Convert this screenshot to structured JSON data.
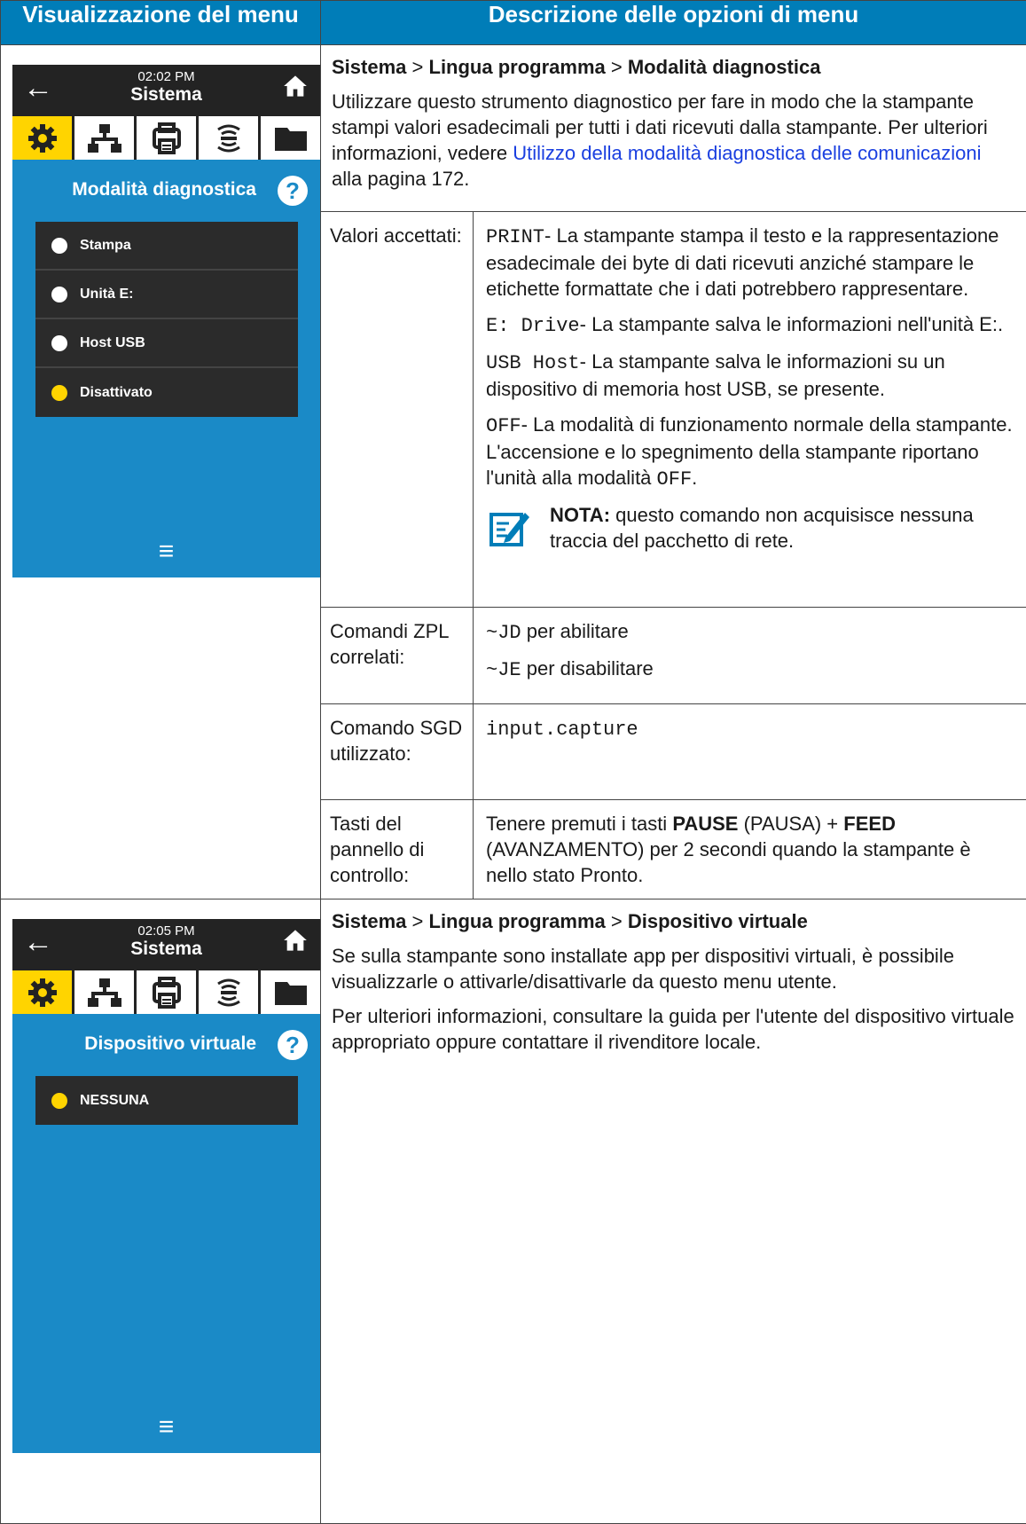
{
  "headers": {
    "left": "Visualizzazione del menu",
    "right": "Descrizione delle opzioni di menu"
  },
  "screen1": {
    "time": "02:02 PM",
    "title": "Sistema",
    "heading": "Modalità diagnostica",
    "items": [
      {
        "label": "Stampa",
        "selected": false
      },
      {
        "label": "Unità E:",
        "selected": false
      },
      {
        "label": "Host USB",
        "selected": false
      },
      {
        "label": "Disattivato",
        "selected": true
      }
    ]
  },
  "screen2": {
    "time": "02:05 PM",
    "title": "Sistema",
    "heading": "Dispositivo virtuale",
    "items": [
      {
        "label": "NESSUNA",
        "selected": true
      }
    ]
  },
  "section1": {
    "crumb": {
      "a": "Sistema",
      "sep": ">",
      "b": "Lingua programma",
      "c": "Modalità diagnostica"
    },
    "intro_before": "Utilizzare questo strumento diagnostico per fare in modo che la stampante stampi valori esadecimali per tutti i dati ricevuti dalla stampante. Per ulteriori informazioni, vedere ",
    "intro_link": "Utilizzo della modalità diagnostica delle comunicazioni",
    "intro_after": " alla pagina 172.",
    "values_label": "Valori accettati:",
    "values": [
      {
        "code": "PRINT",
        "text": "- La stampante stampa il testo e la rappresentazione esadecimale dei byte di dati ricevuti anziché stampare le etichette formattate che i dati potrebbero rappresentare."
      },
      {
        "code": "E: Drive",
        "text": "- La stampante salva le informazioni nell'unità E:."
      },
      {
        "code": "USB Host",
        "text": "- La stampante salva le informazioni su un dispositivo di memoria host USB, se presente."
      },
      {
        "code": "OFF",
        "text": "- La modalità di funzionamento normale della stampante. L'accensione e lo spegnimento della stampante riportano l'unità alla modalità ",
        "code2": "OFF",
        "tail": "."
      }
    ],
    "note_label": "NOTA:",
    "note_text": " questo comando non acquisisce nessuna traccia del pacchetto di rete.",
    "zpl_label": "Comandi ZPL correlati:",
    "zpl": [
      {
        "code": "~JD",
        "text": " per abilitare"
      },
      {
        "code": "~JE",
        "text": " per disabilitare"
      }
    ],
    "sgd_label": "Comando SGD utilizzato:",
    "sgd": "input.capture",
    "keys_label": "Tasti del pannello di controllo:",
    "keys": {
      "t1": "Tenere premuti i tasti ",
      "k1": "PAUSE",
      "t2": " (PAUSA) + ",
      "k2": "FEED",
      "t3": " (AVANZAMENTO) per 2 secondi quando la stampante è nello stato Pronto."
    }
  },
  "section2": {
    "crumb": {
      "a": "Sistema",
      "sep": ">",
      "b": "Lingua programma",
      "c": "Dispositivo virtuale"
    },
    "para1": "Se sulla stampante sono installate app per dispositivi virtuali, è possibile visualizzarle o attivarle/disattivarle da questo menu utente.",
    "para2": "Per ulteriori informazioni, consultare la guida per l'utente del dispositivo virtuale appropriato oppure contattare il rivenditore locale."
  },
  "icons": [
    "back-arrow-icon",
    "home-icon",
    "settings-gear-icon",
    "network-icon",
    "printer-icon",
    "wireless-icon",
    "folder-icon",
    "help-icon",
    "menu-icon",
    "note-icon"
  ],
  "colors": {
    "header_bg": "#007db8",
    "screen_bg": "#1a8ac7",
    "highlight": "#ffd400",
    "link": "#1a3fe0"
  }
}
